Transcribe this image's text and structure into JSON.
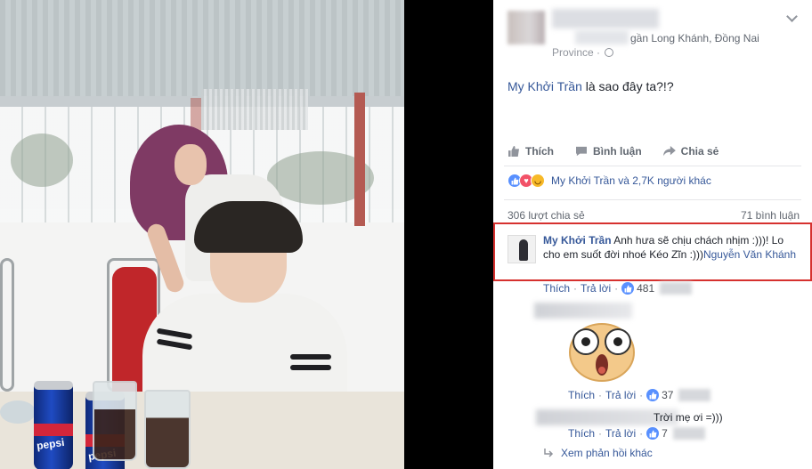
{
  "post": {
    "location": "gần Long Khánh, Đồng Nai",
    "location_region": "Province",
    "caption_mention": "My Khởi Trần",
    "caption_text": " là sao đây ta?!?",
    "actions": {
      "like": "Thích",
      "comment": "Bình luận",
      "share": "Chia sẻ"
    },
    "reactions_text": "My Khởi Trần và 2,7K người khác",
    "shares": "306 lượt chia sẻ",
    "comments_count": "71 bình luận"
  },
  "comment": {
    "author": "My Khởi Trần",
    "text": " Anh hưa sẽ chịu chách nhịm :)))! Lo cho em suốt đời nhoé Kéo Zĩn :)))",
    "mention": "Nguyễn Văn Khánh",
    "like_label": "Thích",
    "reply_label": "Trả lời",
    "likes": "481"
  },
  "reply1": {
    "like_label": "Thích",
    "reply_label": "Trả lời",
    "likes": "37"
  },
  "reply2": {
    "text": "Trời mẹ ơi =)))",
    "like_label": "Thích",
    "reply_label": "Trả lời",
    "likes": "7"
  },
  "more_replies": "Xem phản hồi khác",
  "photo": {
    "can_label": "pepsi"
  },
  "colors": {
    "link": "#365899",
    "like_blue": "#5890ff",
    "highlight": "#d6312f"
  }
}
